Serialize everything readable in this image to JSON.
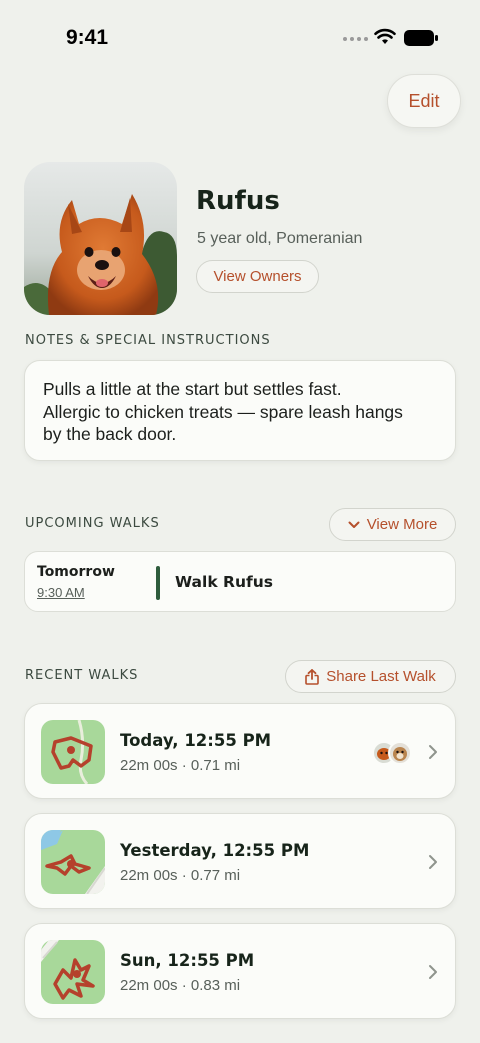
{
  "status_bar": {
    "time": "9:41"
  },
  "header": {
    "edit_label": "Edit"
  },
  "profile": {
    "name": "Rufus",
    "description": "5 year old, Pomeranian",
    "view_owners_label": "View Owners"
  },
  "notes": {
    "label": "NOTES & SPECIAL INSTRUCTIONS",
    "lines": [
      "Pulls a little at the start but settles fast.",
      "Allergic to chicken treats — spare leash hangs",
      "by the back door."
    ]
  },
  "upcoming": {
    "label": "UPCOMING WALKS",
    "view_more_label": "View More",
    "items": [
      {
        "day": "Tomorrow",
        "time": "9:30 AM",
        "title": "Walk Rufus"
      }
    ]
  },
  "recent": {
    "label": "RECENT WALKS",
    "share_label": "Share Last Walk",
    "items": [
      {
        "title": "Today, 12:55 PM",
        "meta": "22m 00s · 0.71 mi"
      },
      {
        "title": "Yesterday, 12:55 PM",
        "meta": "22m 00s · 0.77 mi"
      },
      {
        "title": "Sun, 12:55 PM",
        "meta": "22m 00s · 0.83 mi"
      }
    ]
  },
  "icons": {
    "wifi": "wifi-icon",
    "battery": "battery-icon",
    "chevron_down": "chevron-down-icon",
    "share": "share-icon",
    "chevron_right": "chevron-right-icon"
  },
  "colors": {
    "background": "#eff1ec",
    "accent": "#b5502c",
    "route": "#b5412c",
    "upcoming_bar": "#2e5c3c"
  }
}
